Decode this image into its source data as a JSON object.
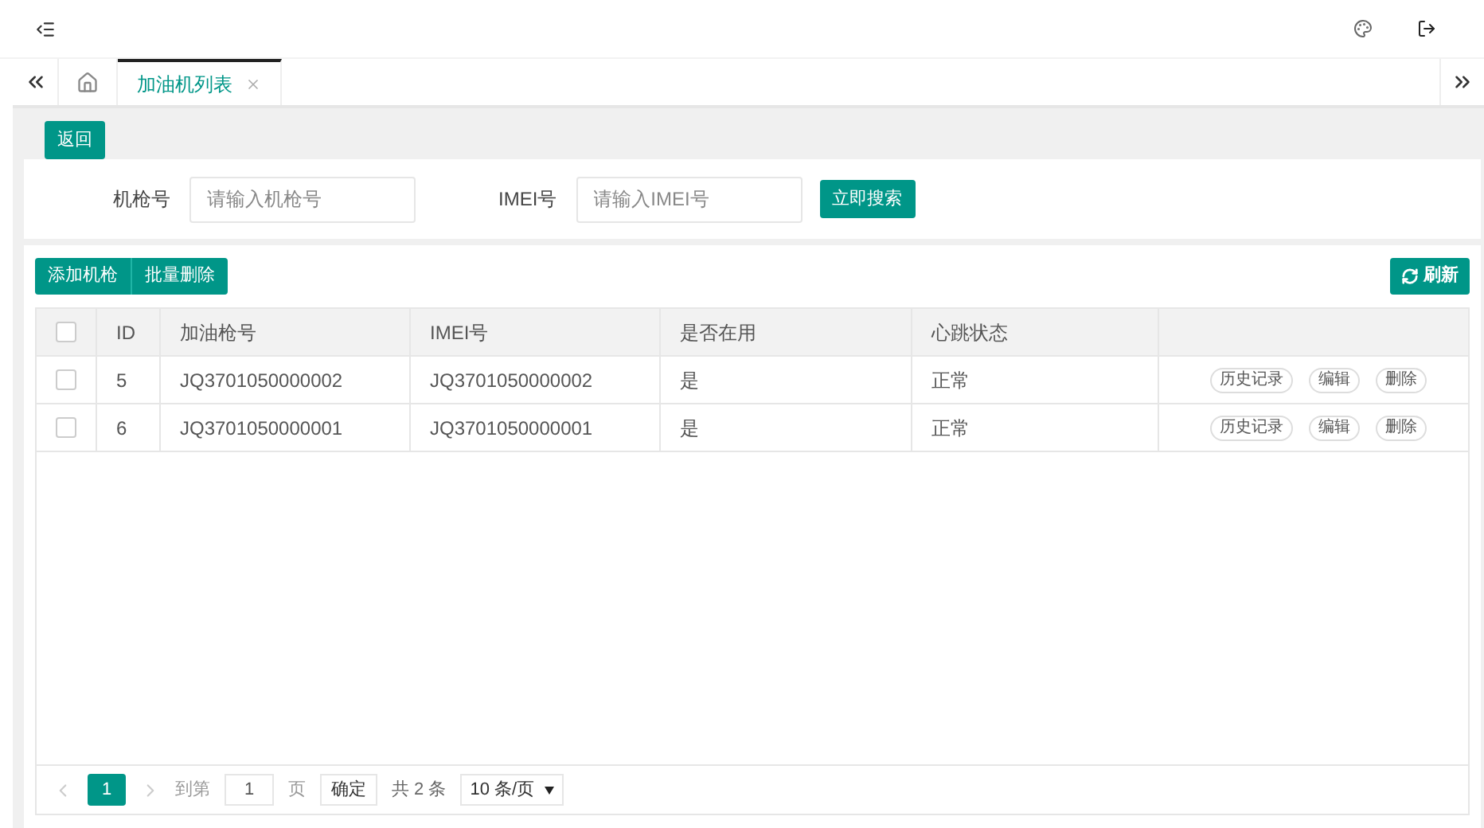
{
  "tabs": [
    {
      "label": "加油机列表",
      "selected": true
    }
  ],
  "back_button": "返回",
  "search": {
    "fields": [
      {
        "label": "机枪号",
        "placeholder": "请输入机枪号"
      },
      {
        "label": "IMEI号",
        "placeholder": "请输入IMEI号"
      }
    ],
    "button": "立即搜索"
  },
  "toolbar": {
    "buttons": [
      "添加机枪",
      "批量删除"
    ],
    "refresh": "刷新"
  },
  "table": {
    "select_all_checked": false,
    "columns": [
      "ID",
      "加油枪号",
      "IMEI号",
      "是否在用",
      "心跳状态"
    ],
    "rows": [
      {
        "checked": false,
        "cells": [
          "5",
          "JQ3701050000002",
          "JQ3701050000002",
          "是",
          "正常"
        ],
        "actions": [
          "历史记录",
          "编辑",
          "删除"
        ]
      },
      {
        "checked": false,
        "cells": [
          "6",
          "JQ3701050000001",
          "JQ3701050000001",
          "是",
          "正常"
        ],
        "actions": [
          "历史记录",
          "编辑",
          "删除"
        ]
      }
    ]
  },
  "pagination": {
    "pages": [
      {
        "label": "1",
        "selected": true
      }
    ],
    "goto_label": "到第",
    "goto_value": "1",
    "page_unit": "页",
    "confirm": "确定",
    "total": "共 2 条",
    "page_size": "10 条/页"
  }
}
